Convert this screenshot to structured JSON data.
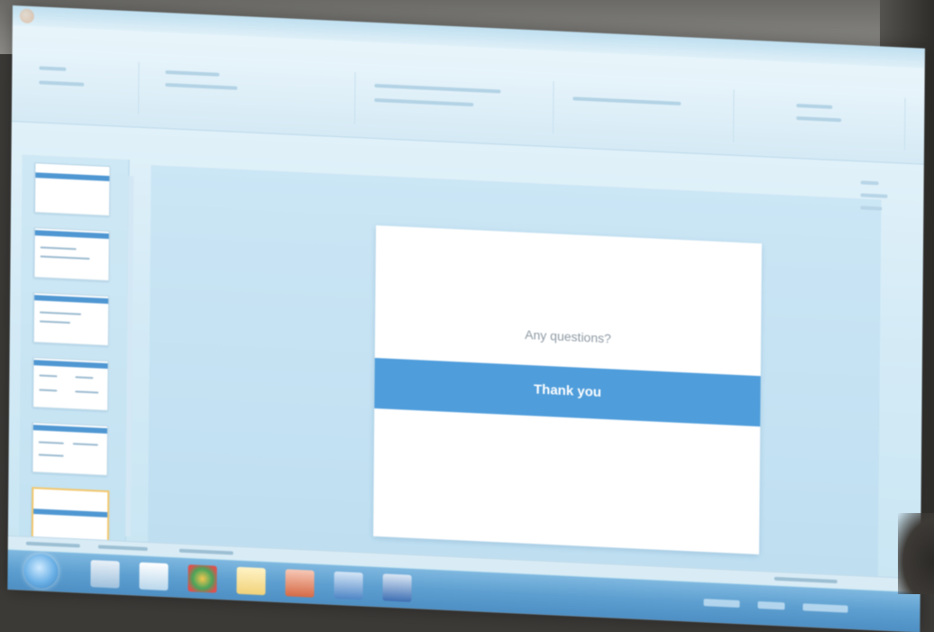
{
  "slide": {
    "question": "Any questions?",
    "thanks": "Thank you"
  },
  "colors": {
    "accent_band": "#4f9ddb",
    "slide_background": "#ffffff",
    "workspace_background": "#c8e5f3",
    "taskbar": "#5d9fd0"
  },
  "thumbnails": {
    "count": 6,
    "selected_index": 5
  },
  "icons": {
    "start": "windows-start-icon",
    "taskbar": [
      "explorer-icon",
      "messenger-icon",
      "chrome-icon",
      "folder-icon",
      "powerpoint-icon",
      "outlook-icon",
      "word-icon"
    ]
  }
}
